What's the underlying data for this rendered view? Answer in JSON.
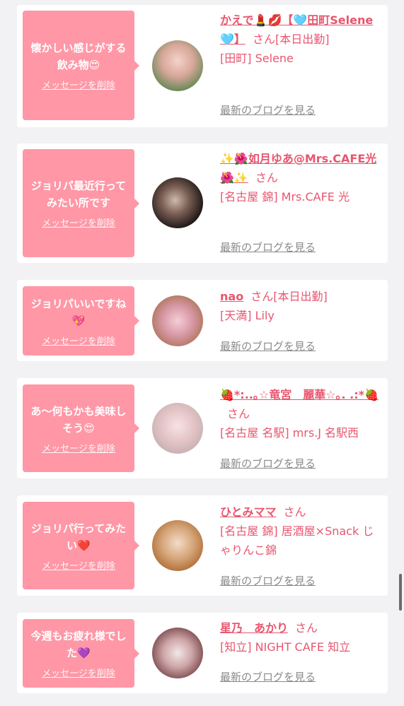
{
  "delete_label": "メッセージを削除",
  "blog_label": "最新のブログを見る",
  "san_label": "さん",
  "cards": [
    {
      "message": "懐かしい感じがする飲み物😍",
      "name": "かえで💄💋【🩵田町Selene🩵】",
      "shop": "[田町] Selene"
    },
    {
      "message": "ジョリパ最近行ってみたい所です",
      "name": "✨🌺如月ゆあ@Mrs.CAFE光🌺✨",
      "shop": "[名古屋 錦] Mrs.CAFE 光"
    },
    {
      "message": "ジョリパいいですね💖",
      "name": "nao",
      "status": "[本日出勤]",
      "shop": "[天満] Lily"
    },
    {
      "message": "あ〜何もかも美味しそう😍",
      "name": "🍓*:..｡☆竜宮　麗華☆｡. .:*🍓",
      "shop": "[名古屋 名駅] mrs.J 名駅西"
    },
    {
      "message": "ジョリパ行ってみたい❤️",
      "name": "ひとみママ",
      "shop": "[名古屋 錦] 居酒屋×Snack じゃりんこ錦"
    },
    {
      "message": "今週もお疲れ様でした💜",
      "name": "星乃　あかり",
      "shop": "[知立] NIGHT CAFE 知立"
    }
  ],
  "card0_status": "[本日出勤]"
}
